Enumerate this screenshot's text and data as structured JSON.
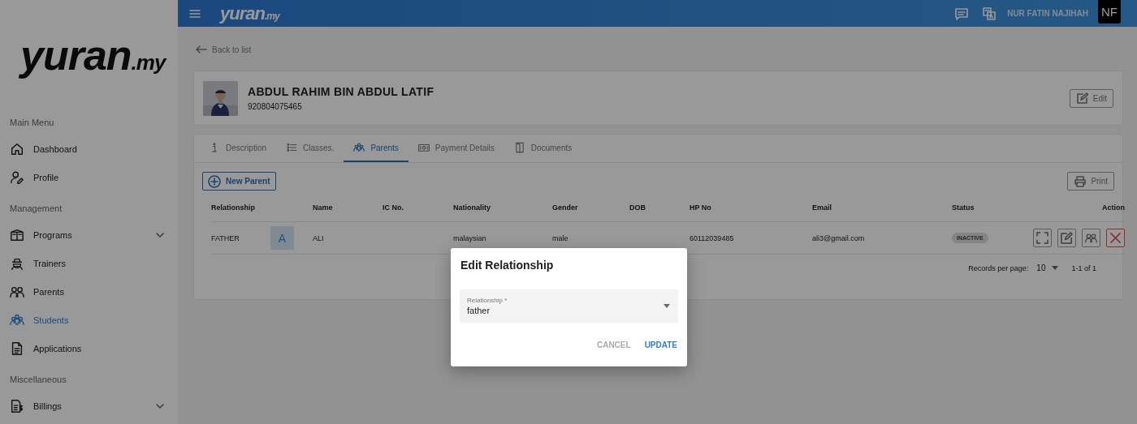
{
  "topbar": {
    "logo": {
      "main": "yuran",
      "suffix": ".my"
    },
    "user_name": "NUR FATIN NAJIHAH",
    "user_initials": "NF"
  },
  "sidebar": {
    "logo": {
      "main": "yuran",
      "suffix": ".my"
    },
    "sections": [
      {
        "title": "Main Menu",
        "items": [
          {
            "label": "Dashboard",
            "kind": "link",
            "selected": false
          },
          {
            "label": "Profile",
            "kind": "link",
            "selected": false
          }
        ]
      },
      {
        "title": "Management",
        "items": [
          {
            "label": "Programs",
            "kind": "group",
            "expanded": false,
            "selected": false
          },
          {
            "label": "Trainers",
            "kind": "link",
            "selected": false
          },
          {
            "label": "Parents",
            "kind": "link",
            "selected": false
          },
          {
            "label": "Students",
            "kind": "link",
            "selected": true
          },
          {
            "label": "Applications",
            "kind": "link",
            "selected": false
          }
        ]
      },
      {
        "title": "Miscellaneous",
        "items": [
          {
            "label": "Billings",
            "kind": "group",
            "expanded": false,
            "selected": false
          }
        ]
      }
    ]
  },
  "back_link": "Back to list",
  "student": {
    "name": "ABDUL RAHIM BIN ABDUL LATIF",
    "ic_no": "920804075465",
    "edit_button": "Edit"
  },
  "tabs": [
    {
      "label": "Description",
      "selected": false
    },
    {
      "label": "Classes.",
      "selected": false
    },
    {
      "label": "Parents",
      "selected": true
    },
    {
      "label": "Payment Details",
      "selected": false
    },
    {
      "label": "Documents",
      "selected": false
    }
  ],
  "new_parent_button": "New Parent",
  "print_button": "Print",
  "table": {
    "columns": [
      "Relationship",
      "Name",
      "IC No.",
      "Nationality",
      "Gender",
      "DOB",
      "HP No",
      "Email",
      "Status",
      "Action"
    ],
    "rows": [
      {
        "relationship": "FATHER",
        "avatar": "A",
        "name": "ALI",
        "nationality": "malaysian",
        "gender": "male",
        "hp_no": "60112039485",
        "email": "ali3@gmail.com",
        "status": "INACTIVE"
      }
    ]
  },
  "pagination": {
    "label": "Records per page:",
    "per_page": "10",
    "range": "1-1 of 1"
  },
  "dialog": {
    "title": "Edit Relationship",
    "field": {
      "label": "Relationship *",
      "value": "father"
    },
    "buttons": [
      {
        "label": "CANCEL",
        "kind": "secondary"
      },
      {
        "label": "UPDATE",
        "kind": "primary"
      }
    ]
  }
}
